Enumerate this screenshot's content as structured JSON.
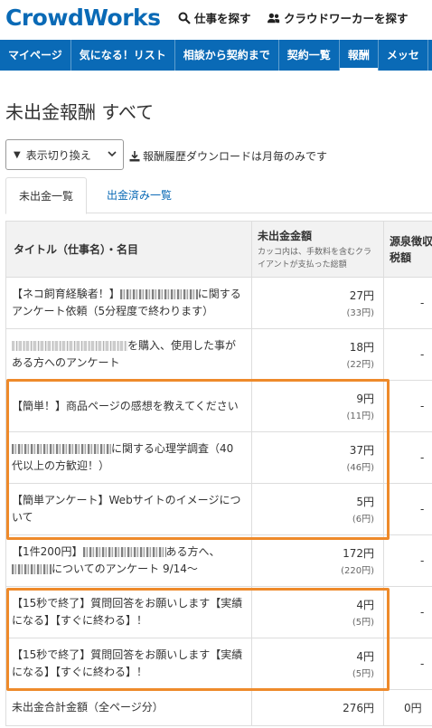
{
  "header": {
    "logo": "CrowdWorks",
    "find_work": "仕事を探す",
    "find_workers": "クラウドワーカーを探す"
  },
  "nav": {
    "items": [
      {
        "label": "マイページ"
      },
      {
        "label": "気になる！リスト"
      },
      {
        "label": "相談から契約まで"
      },
      {
        "label": "契約一覧"
      },
      {
        "label": "報酬"
      },
      {
        "label": "メッセ"
      }
    ]
  },
  "page": {
    "title": "未出金報酬 すべて"
  },
  "toolbar": {
    "select_label": "表示切り換え",
    "download_note": "報酬履歴ダウンロードは月毎のみです"
  },
  "tabs": [
    {
      "label": "未出金一覧"
    },
    {
      "label": "出金済み一覧"
    }
  ],
  "table": {
    "headers": {
      "title": "タイトル（仕事名）・名目",
      "amount": "未出金金額",
      "amount_note": "カッコ内は、手数料を含むクライアントが支払った総額",
      "tax": "源泉徴収税額"
    },
    "rows": [
      {
        "title_pre": "【ネコ飼育経験者！】",
        "title_post": "に関するアンケート依頼（5分程度で終わります）",
        "amount": "27円",
        "gross": "(33円)",
        "tax": "-"
      },
      {
        "title_pre": "",
        "title_post": "を購入、使用した事がある方へのアンケート",
        "amount": "18円",
        "gross": "(22円)",
        "tax": "-"
      },
      {
        "title_pre": "【簡単！】商品ページの感想を教えてください",
        "title_post": "",
        "amount": "9円",
        "gross": "(11円)",
        "tax": "-"
      },
      {
        "title_pre": "",
        "title_post": "に関する心理学調査（40代以上の方歓迎！）",
        "amount": "37円",
        "gross": "(46円)",
        "tax": "-"
      },
      {
        "title_pre": "【簡単アンケート】Webサイトのイメージについて",
        "title_post": "",
        "amount": "5円",
        "gross": "(6円)",
        "tax": "-"
      },
      {
        "title_pre": "【1件200円】",
        "title_post": "ある方へ、",
        "title_post2": "についてのアンケート 9/14〜",
        "amount": "172円",
        "gross": "(220円)",
        "tax": "-"
      },
      {
        "title_pre": "【15秒で終了】質問回答をお願いします【実績になる】【すぐに終わる】！",
        "title_post": "",
        "amount": "4円",
        "gross": "(5円)",
        "tax": "-"
      },
      {
        "title_pre": "【15秒で終了】質問回答をお願いします【実績になる】【すぐに終わる】！",
        "title_post": "",
        "amount": "4円",
        "gross": "(5円)",
        "tax": "-"
      }
    ],
    "total": {
      "label": "未出金合計金額（全ページ分）",
      "amount": "276円",
      "tax": "0円"
    }
  },
  "icons": {
    "search": "search-icon",
    "people": "people-icon",
    "download": "download-icon",
    "chevron": "chevron-down-icon"
  },
  "colors": {
    "brand": "#0a6ab6",
    "highlight": "#ee8a2b"
  }
}
